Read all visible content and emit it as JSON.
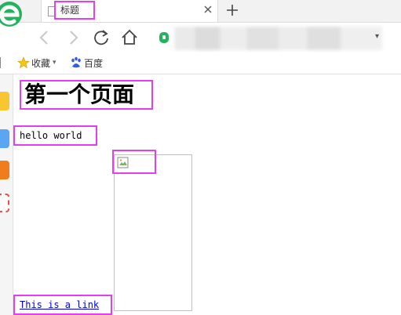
{
  "tab": {
    "title": "标题"
  },
  "bookmarks": [
    {
      "label": "收藏",
      "icon": "star-icon"
    },
    {
      "label": "百度",
      "icon": "baidu-paw-icon"
    }
  ],
  "page": {
    "heading": "第一个页面",
    "paragraph": "hello world",
    "image": "broken-image-icon",
    "link": "This is a link"
  },
  "colors": {
    "highlight": "#e33ef0",
    "link": "#0000ee",
    "brand": "#23b35e"
  }
}
